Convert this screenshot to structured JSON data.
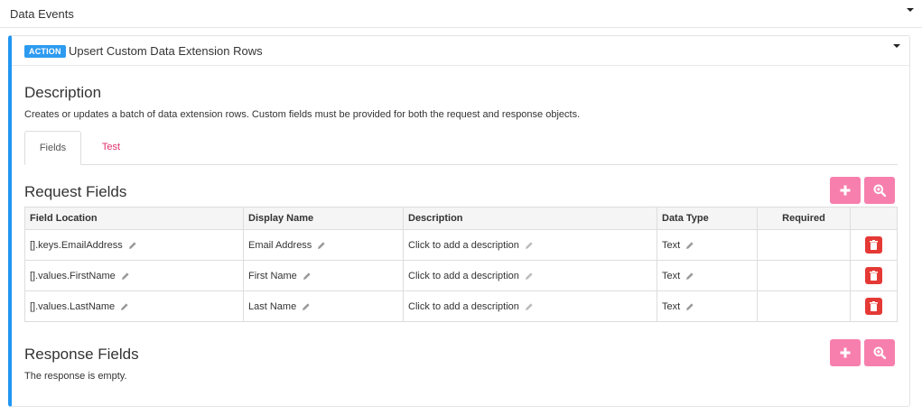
{
  "header": {
    "title": "Data Events"
  },
  "action": {
    "badge": "ACTION",
    "title": "Upsert Custom Data Extension Rows"
  },
  "description": {
    "heading": "Description",
    "text": "Creates or updates a batch of data extension rows. Custom fields must be provided for both the request and response objects."
  },
  "tabs": [
    {
      "label": "Fields",
      "active": true
    },
    {
      "label": "Test",
      "active": false
    }
  ],
  "request": {
    "heading": "Request Fields",
    "columns": [
      "Field Location",
      "Display Name",
      "Description",
      "Data Type",
      "Required"
    ],
    "rows": [
      {
        "location": "[].keys.EmailAddress",
        "display": "Email Address",
        "description": "Click to add a description",
        "type": "Text"
      },
      {
        "location": "[].values.FirstName",
        "display": "First Name",
        "description": "Click to add a description",
        "type": "Text"
      },
      {
        "location": "[].values.LastName",
        "display": "Last Name",
        "description": "Click to add a description",
        "type": "Text"
      }
    ]
  },
  "response": {
    "heading": "Response Fields",
    "empty_text": "The response is empty."
  },
  "icons": {
    "add": "plus-icon",
    "search": "zoom-in-icon",
    "edit": "pencil-icon",
    "delete": "trash-icon",
    "collapse": "caret-down-icon"
  },
  "colors": {
    "accent": "#2196f3",
    "badge": "#2d9bf0",
    "button_pink": "#f77fad",
    "delete_red": "#e53935",
    "tab_active_text": "#e1306c"
  }
}
